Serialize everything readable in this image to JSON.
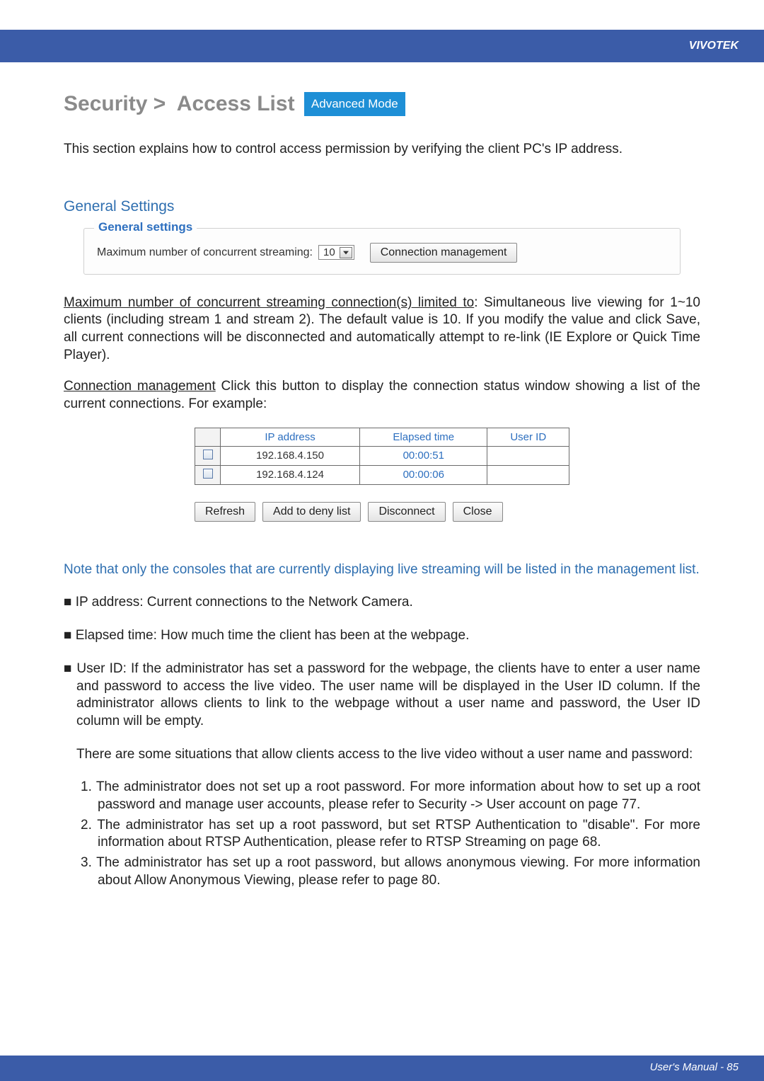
{
  "brand": "VIVOTEK",
  "title": {
    "prefix": "Security >  Access List ",
    "badge": "Advanced Mode"
  },
  "intro": "This section explains how to control access permission by verifying the client PC's IP address.",
  "section_heading": "General Settings",
  "general_settings": {
    "legend": "General settings",
    "label": "Maximum number of concurrent streaming:",
    "dropdown_value": "10",
    "conn_mgmt_btn": "Connection management"
  },
  "para_max_conn_head": "Maximum number of concurrent streaming connection(s) limited to",
  "para_max_conn_body": ": Simultaneous live viewing for 1~10 clients (including stream 1 and stream 2). The default value is 10. If you modify the value and click Save, all current connections will be disconnected and automatically attempt to re-link (IE Explore or Quick Time Player).",
  "para_conn_mgmt_head": "Connection management",
  "para_conn_mgmt_body": " Click this button to display the connection status window showing a list of the current connections. For example:",
  "conn_table": {
    "headers": [
      "IP address",
      "Elapsed time",
      "User ID"
    ],
    "rows": [
      {
        "ip": "192.168.4.150",
        "elapsed": "00:00:51",
        "user": ""
      },
      {
        "ip": "192.168.4.124",
        "elapsed": "00:00:06",
        "user": ""
      }
    ],
    "buttons": [
      "Refresh",
      "Add to deny list",
      "Disconnect",
      "Close"
    ]
  },
  "blue_note": "Note that only the consoles that are currently displaying live streaming will be listed in the management list.",
  "bullets": {
    "ip_addr": "■ IP address: Current connections to the Network Camera.",
    "elapsed": "■ Elapsed time: How much time the client has been at the webpage.",
    "user_id_lead": "■ User ID: If the administrator has set a password for the webpage, the clients have to enter a user name and password to access the live video. The user name will be displayed in the User ID column. If  the administrator allows clients to link to the webpage without a user name and password, the User ID column will be empty.",
    "situations_lead": "There are some situations that allow clients access to the live video without a user name and password:",
    "situations": [
      "1. The administrator does not set up a root password. For more information about how to set up a root password and manage user accounts, please refer to Security -> User account on page 77.",
      "2. The administrator has set up a root password, but set RTSP Authentication to \"disable\". For more information about RTSP Authentication, please refer to RTSP Streaming on page 68.",
      "3. The administrator has set up a root password, but allows anonymous viewing. For more information about Allow Anonymous Viewing, please refer to page 80."
    ]
  },
  "footer": "User's Manual - 85"
}
